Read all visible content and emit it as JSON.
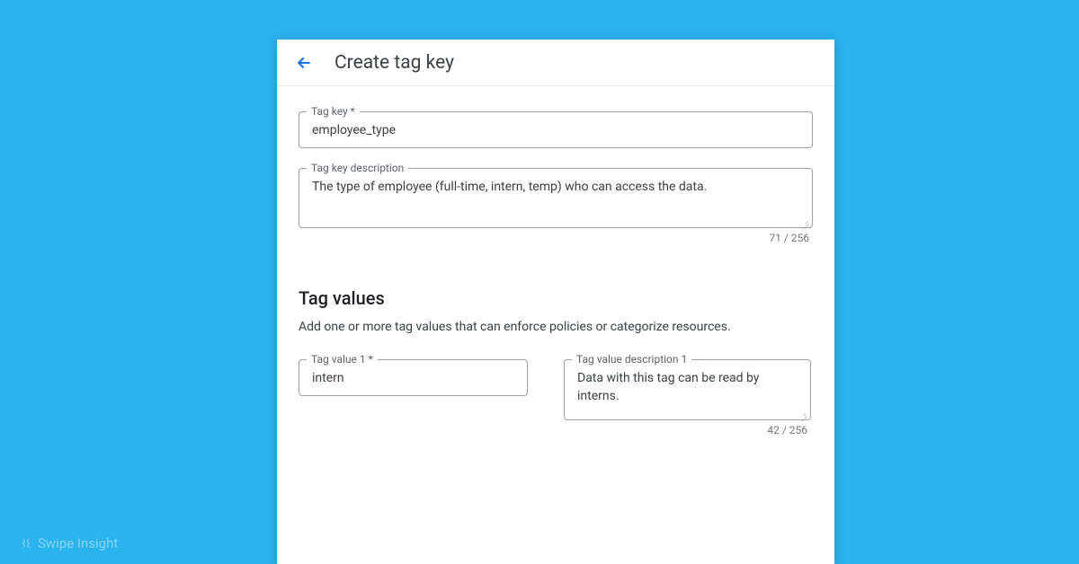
{
  "header": {
    "title": "Create tag key"
  },
  "tag_key_field": {
    "label": "Tag key *",
    "value": "employee_type"
  },
  "tag_key_desc_field": {
    "label": "Tag key description",
    "value": "The type of employee (full-time, intern, temp) who can access the data.",
    "counter": "71 / 256"
  },
  "tag_values_section": {
    "title": "Tag values",
    "subtitle": "Add one or more tag values that can enforce policies or categorize resources."
  },
  "tag_value_1": {
    "label": "Tag value 1 *",
    "value": "intern"
  },
  "tag_value_desc_1": {
    "label": "Tag value description 1",
    "value": "Data with this tag can be read by interns.",
    "counter": "42 / 256"
  },
  "watermark": {
    "text": "Swipe Insight"
  }
}
